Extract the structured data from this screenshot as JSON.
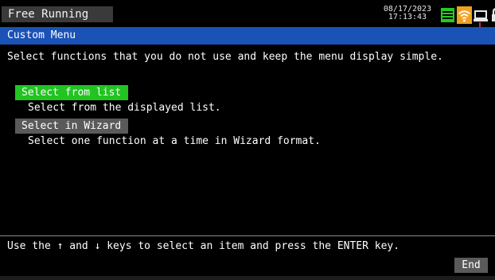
{
  "status_bar": {
    "mode": "Free Running",
    "date": "08/17/2023",
    "time": "17:13:43",
    "icons": [
      "memory-green-icon",
      "wifi-orange-icon",
      "network-icon",
      "lock-icon"
    ]
  },
  "title": "Custom Menu",
  "description": "Select functions that you do not use and keep the menu display simple.",
  "options": [
    {
      "label": "Select from list",
      "description": "Select from the displayed list.",
      "selected": true
    },
    {
      "label": "Select in Wizard",
      "description": "Select one function at a time in Wizard format.",
      "selected": false
    }
  ],
  "footer": {
    "hint": "Use the ↑ and ↓ keys to select an item and press the ENTER key.",
    "end_label": "End"
  },
  "colors": {
    "title_bar": "#1a52b8",
    "selected": "#21c421",
    "button": "#5a5a5a",
    "status_box": "#3a3a3a",
    "accent_orange": "#f0a020",
    "accent_green": "#22cc22"
  }
}
